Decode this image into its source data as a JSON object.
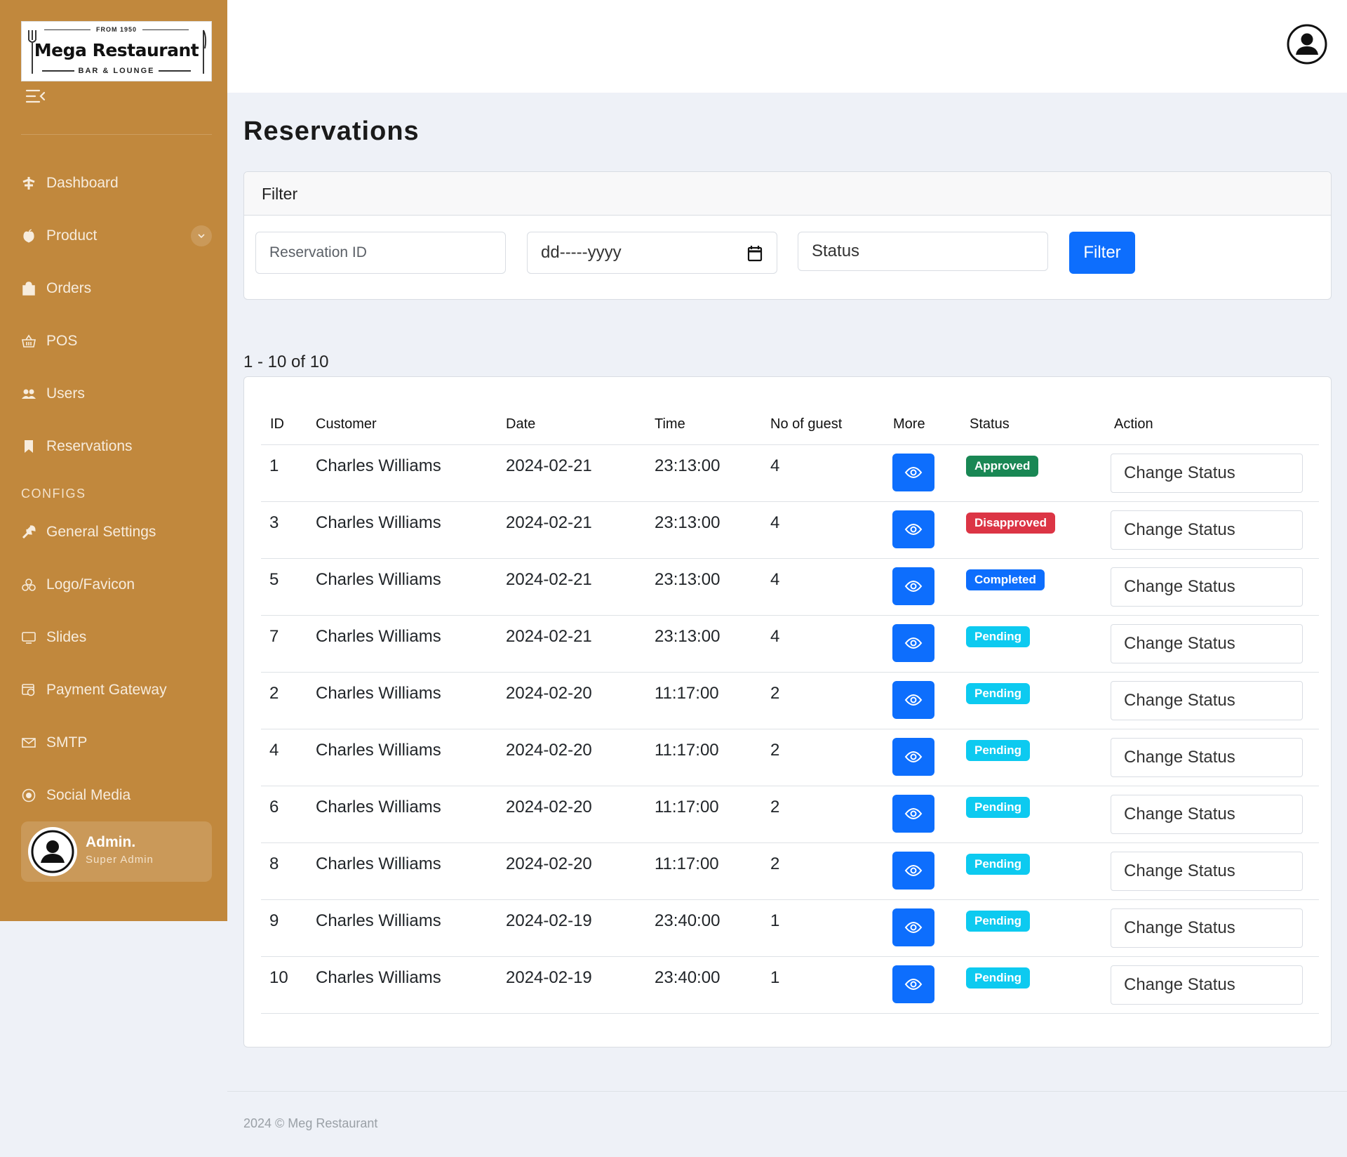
{
  "brand": {
    "from": "FROM 1950",
    "name": "Mega Restaurant",
    "sub": "BAR & LOUNGE"
  },
  "sidebar": {
    "items": [
      {
        "label": "Dashboard",
        "icon": "dashboard-icon"
      },
      {
        "label": "Product",
        "icon": "apple-icon"
      },
      {
        "label": "Orders",
        "icon": "shopping-bag-icon"
      },
      {
        "label": "POS",
        "icon": "basket-icon"
      },
      {
        "label": "Users",
        "icon": "users-icon"
      },
      {
        "label": "Reservations",
        "icon": "bookmark-icon"
      }
    ],
    "configs_label": "CONFIGS",
    "configs": [
      {
        "label": "General Settings",
        "icon": "wrench-icon"
      },
      {
        "label": "Logo/Favicon",
        "icon": "logo-icon"
      },
      {
        "label": "Slides",
        "icon": "monitor-icon"
      },
      {
        "label": "Payment Gateway",
        "icon": "payment-icon"
      },
      {
        "label": "SMTP",
        "icon": "mail-icon"
      },
      {
        "label": "Social Media",
        "icon": "social-icon"
      }
    ],
    "admin": {
      "name": "Admin.",
      "role": "Super Admin"
    }
  },
  "page": {
    "title": "Reservations"
  },
  "filter": {
    "header": "Filter",
    "reservation_placeholder": "Reservation ID",
    "date_placeholder": "dd-----yyyy",
    "status_label": "Status",
    "button": "Filter"
  },
  "table": {
    "count": "1 - 10 of 10",
    "headers": [
      "ID",
      "Customer",
      "Date",
      "Time",
      "No of guest",
      "More",
      "Status",
      "Action"
    ],
    "action_label": "Change Status",
    "rows": [
      {
        "id": "1",
        "customer": "Charles Williams",
        "date": "2024-02-21",
        "time": "23:13:00",
        "guests": "4",
        "status": "Approved",
        "status_color": "#198754"
      },
      {
        "id": "3",
        "customer": "Charles Williams",
        "date": "2024-02-21",
        "time": "23:13:00",
        "guests": "4",
        "status": "Disapproved",
        "status_color": "#dc3545"
      },
      {
        "id": "5",
        "customer": "Charles Williams",
        "date": "2024-02-21",
        "time": "23:13:00",
        "guests": "4",
        "status": "Completed",
        "status_color": "#0d6efd"
      },
      {
        "id": "7",
        "customer": "Charles Williams",
        "date": "2024-02-21",
        "time": "23:13:00",
        "guests": "4",
        "status": "Pending",
        "status_color": "#0dcaf0"
      },
      {
        "id": "2",
        "customer": "Charles Williams",
        "date": "2024-02-20",
        "time": "11:17:00",
        "guests": "2",
        "status": "Pending",
        "status_color": "#0dcaf0"
      },
      {
        "id": "4",
        "customer": "Charles Williams",
        "date": "2024-02-20",
        "time": "11:17:00",
        "guests": "2",
        "status": "Pending",
        "status_color": "#0dcaf0"
      },
      {
        "id": "6",
        "customer": "Charles Williams",
        "date": "2024-02-20",
        "time": "11:17:00",
        "guests": "2",
        "status": "Pending",
        "status_color": "#0dcaf0"
      },
      {
        "id": "8",
        "customer": "Charles Williams",
        "date": "2024-02-20",
        "time": "11:17:00",
        "guests": "2",
        "status": "Pending",
        "status_color": "#0dcaf0"
      },
      {
        "id": "9",
        "customer": "Charles Williams",
        "date": "2024-02-19",
        "time": "23:40:00",
        "guests": "1",
        "status": "Pending",
        "status_color": "#0dcaf0"
      },
      {
        "id": "10",
        "customer": "Charles Williams",
        "date": "2024-02-19",
        "time": "23:40:00",
        "guests": "1",
        "status": "Pending",
        "status_color": "#0dcaf0"
      }
    ]
  },
  "colors": {
    "sidebar": "#c1883d",
    "primary": "#0d6efd"
  },
  "footer": "2024 © Meg Restaurant"
}
